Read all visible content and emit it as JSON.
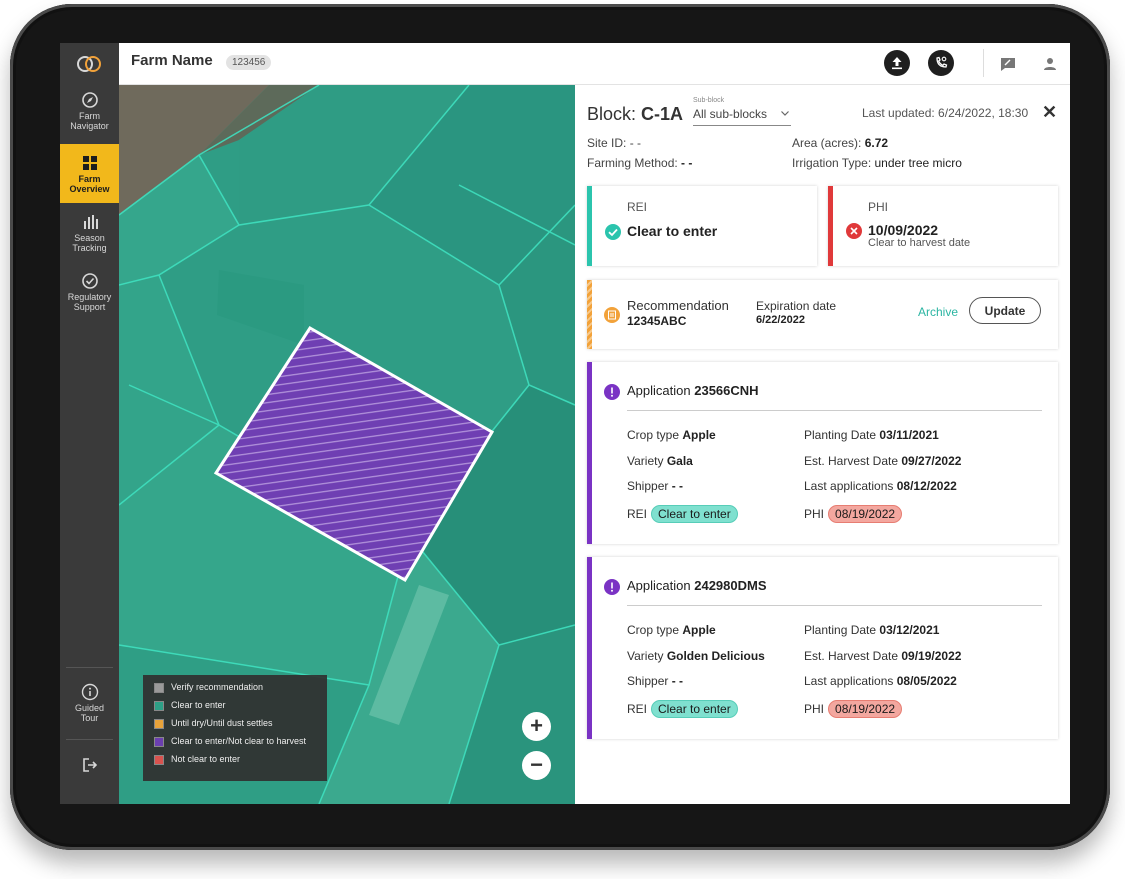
{
  "header": {
    "farm_name": "Farm Name",
    "farm_id": "123456"
  },
  "sidebar": {
    "items": [
      {
        "label_1": "Farm",
        "label_2": "Navigator",
        "icon": "navigator-icon"
      },
      {
        "label_1": "Farm",
        "label_2": "Overview",
        "icon": "grid-icon",
        "active": true
      },
      {
        "label_1": "Season",
        "label_2": "Tracking",
        "icon": "bar-chart-icon"
      },
      {
        "label_1": "Regulatory",
        "label_2": "Support",
        "icon": "badge-check-icon"
      }
    ],
    "guided_tour": {
      "label_1": "Guided",
      "label_2": "Tour"
    }
  },
  "map": {
    "legend": [
      {
        "label": "Verify recommendation",
        "color": "#9a9a9a"
      },
      {
        "label": "Clear to enter",
        "color": "#2e9f86"
      },
      {
        "label": "Until dry/Until dust settles",
        "color": "#e8a33a"
      },
      {
        "label": "Clear to enter/Not clear to harvest",
        "color": "#6b3fb0"
      },
      {
        "label": "Not clear to enter",
        "color": "#d9534f"
      }
    ],
    "zoom_in": "+",
    "zoom_out": "−"
  },
  "panel": {
    "block_prefix": "Block:",
    "block_name": "C-1A",
    "subblock_label": "Sub-block",
    "subblock_value": "All sub-blocks",
    "last_updated": "Last updated: 6/24/2022, 18:30",
    "site_id_label": "Site ID:",
    "site_id_value": "- -",
    "farming_method_label": "Farming Method:",
    "farming_method_value": "- -",
    "area_label": "Area (acres):",
    "area_value": "6.72",
    "irrigation_label": "Irrigation Type:",
    "irrigation_value": "under tree micro",
    "rei": {
      "title": "REI",
      "value": "Clear to enter",
      "color": "#2bc4ad"
    },
    "phi": {
      "title": "PHI",
      "date": "10/09/2022",
      "sub": "Clear to harvest date",
      "color": "#e0393a"
    },
    "recommendation": {
      "title": "Recommendation",
      "id": "12345ABC",
      "exp_label": "Expiration date",
      "exp_value": "6/22/2022",
      "archive": "Archive",
      "update": "Update",
      "color": "#f2a23a"
    },
    "applications": [
      {
        "title_prefix": "Application",
        "id": "23566CNH",
        "crop_label": "Crop type",
        "crop": "Apple",
        "variety_label": "Variety",
        "variety": "Gala",
        "shipper_label": "Shipper",
        "shipper": "- -",
        "rei_label": "REI",
        "rei": "Clear to enter",
        "planting_label": "Planting Date",
        "planting": "03/11/2021",
        "harvest_label": "Est. Harvest Date",
        "harvest": "09/27/2022",
        "lastapp_label": "Last applications",
        "lastapp": "08/12/2022",
        "phi_label": "PHI",
        "phi": "08/19/2022"
      },
      {
        "title_prefix": "Application",
        "id": "242980DMS",
        "crop_label": "Crop type",
        "crop": "Apple",
        "variety_label": "Variety",
        "variety": "Golden Delicious",
        "shipper_label": "Shipper",
        "shipper": "- -",
        "rei_label": "REI",
        "rei": "Clear to enter",
        "planting_label": "Planting Date",
        "planting": "03/12/2021",
        "harvest_label": "Est. Harvest Date",
        "harvest": "09/19/2022",
        "lastapp_label": "Last applications",
        "lastapp": "08/05/2022",
        "phi_label": "PHI",
        "phi": "08/19/2022"
      }
    ],
    "app_color": "#7a33c4"
  }
}
